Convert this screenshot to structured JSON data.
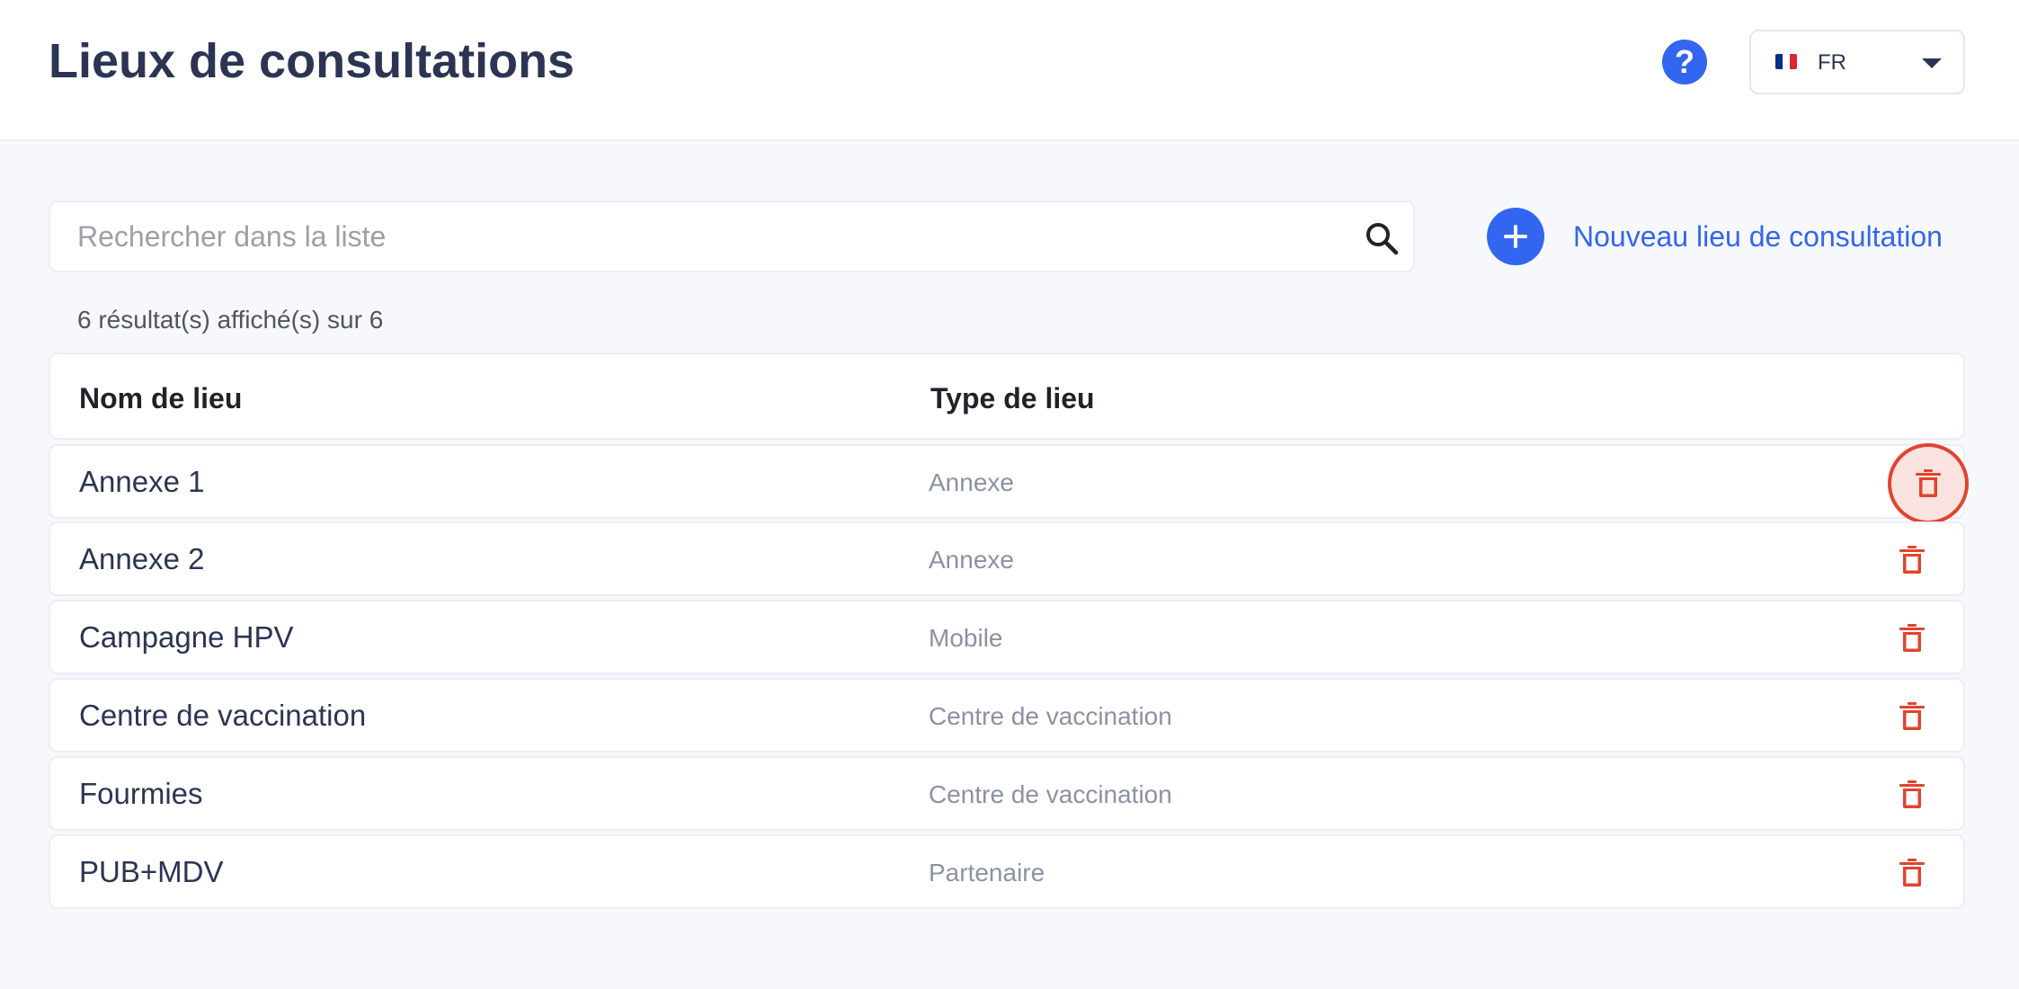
{
  "header": {
    "title": "Lieux de consultations",
    "help_label": "?",
    "language": {
      "code": "FR",
      "flag_colors": [
        "#0a2e8c",
        "#ffffff",
        "#e02633"
      ]
    }
  },
  "toolbar": {
    "search_placeholder": "Rechercher dans la liste",
    "search_value": "",
    "add_label": "Nouveau lieu de consultation"
  },
  "results": {
    "summary": "6 résultat(s) affiché(s) sur 6"
  },
  "table": {
    "columns": [
      "Nom de lieu",
      "Type de lieu"
    ],
    "rows": [
      {
        "name": "Annexe 1",
        "type": "Annexe"
      },
      {
        "name": "Annexe 2",
        "type": "Annexe"
      },
      {
        "name": "Campagne HPV",
        "type": "Mobile"
      },
      {
        "name": "Centre de vaccination",
        "type": "Centre de vaccination"
      },
      {
        "name": "Fourmies",
        "type": "Centre de vaccination"
      },
      {
        "name": "PUB+MDV",
        "type": "Partenaire"
      }
    ]
  },
  "colors": {
    "accent": "#3366f0",
    "danger": "#e0442f",
    "text": "#2b3553",
    "muted": "#8b92a3"
  },
  "icons": {
    "help": "help-icon",
    "search": "search-icon",
    "add": "plus-icon",
    "delete": "trash-icon",
    "dropdown": "caret-down-icon"
  }
}
